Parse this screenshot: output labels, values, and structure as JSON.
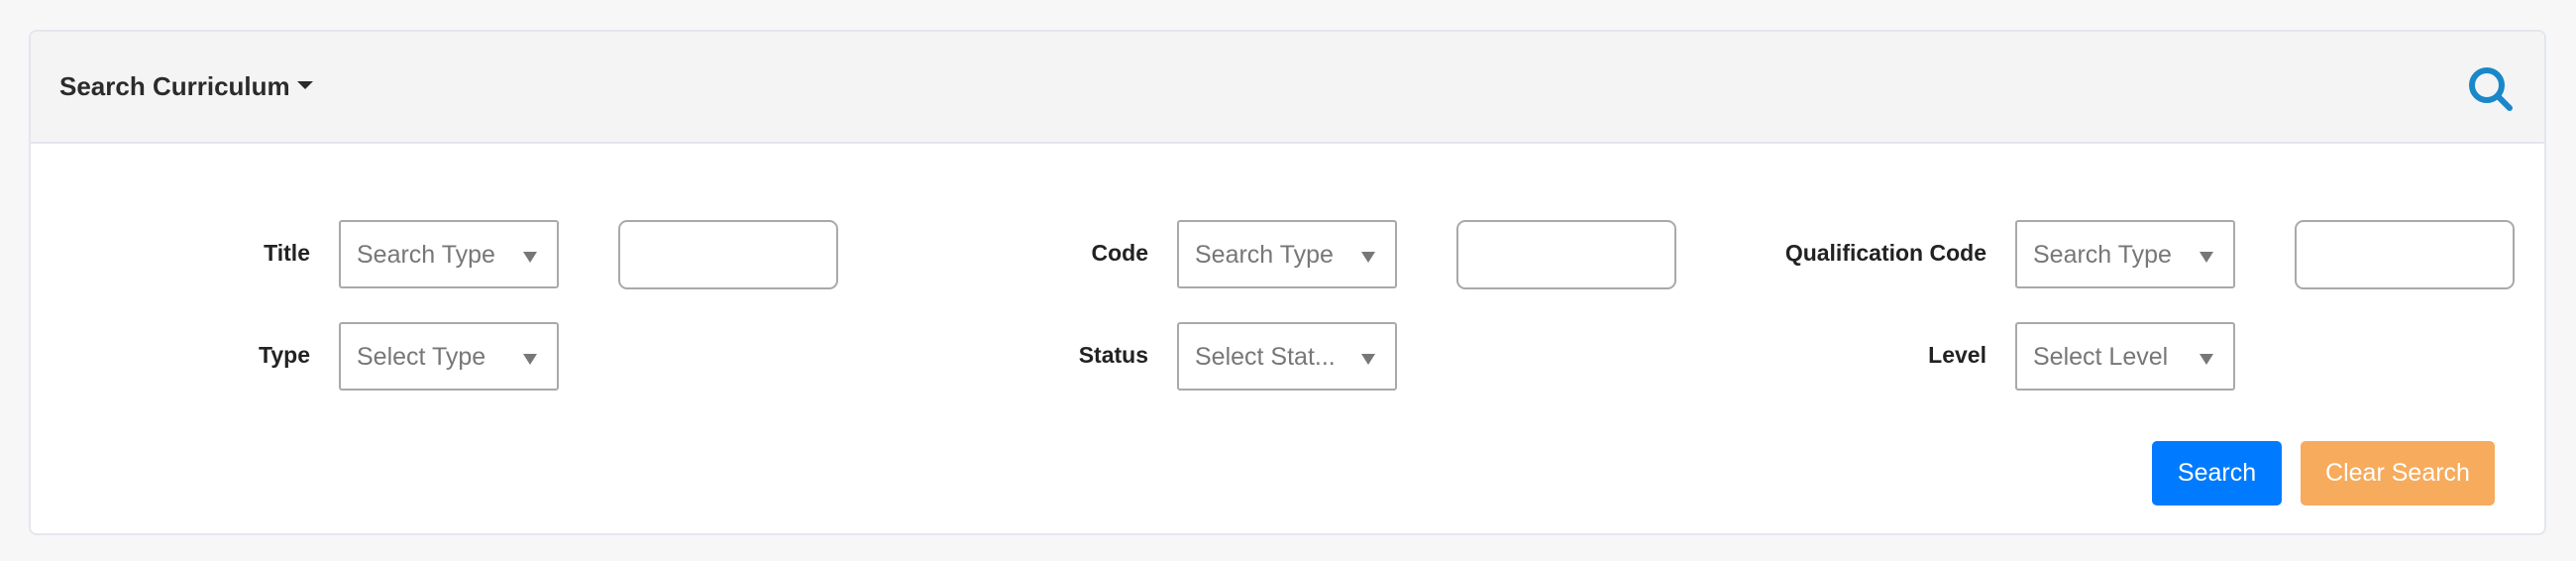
{
  "header": {
    "title": "Search Curriculum",
    "caret_icon": "caret-down-icon",
    "search_icon": "search-icon",
    "accent_color": "#1a87c9"
  },
  "fields": {
    "title": {
      "label": "Title",
      "search_type_placeholder": "Search Type",
      "value": ""
    },
    "code": {
      "label": "Code",
      "search_type_placeholder": "Search Type",
      "value": ""
    },
    "qualification_code": {
      "label": "Qualification Code",
      "search_type_placeholder": "Search Type",
      "value": ""
    },
    "type": {
      "label": "Type",
      "placeholder": "Select Type"
    },
    "status": {
      "label": "Status",
      "placeholder": "Select Stat..."
    },
    "level": {
      "label": "Level",
      "placeholder": "Select Level"
    }
  },
  "buttons": {
    "search_label": "Search",
    "search_color": "#007bff",
    "clear_label": "Clear Search",
    "clear_color": "#f7ab5c"
  }
}
